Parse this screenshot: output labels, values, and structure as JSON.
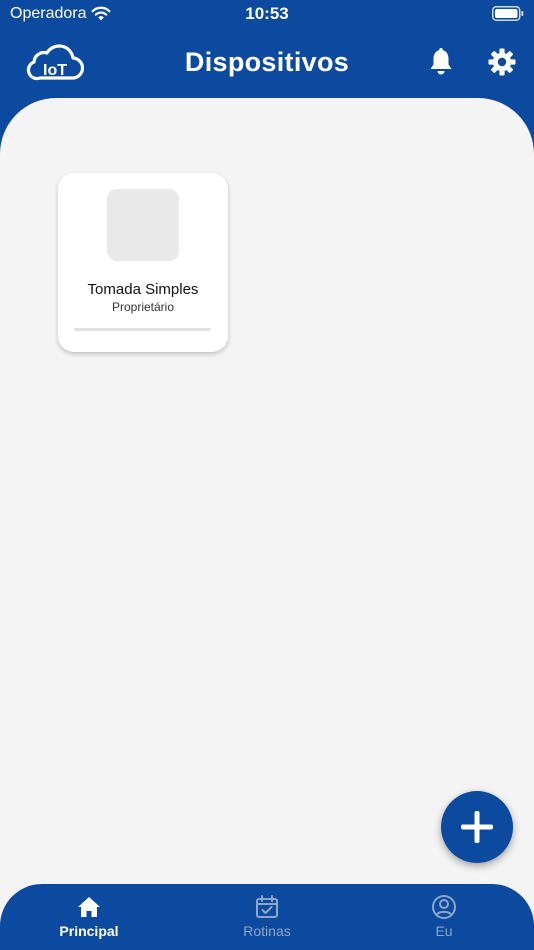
{
  "status_bar": {
    "carrier": "Operadora",
    "time": "10:53"
  },
  "header": {
    "title": "Dispositivos",
    "logo_text": "IoT"
  },
  "devices": [
    {
      "name": "Tomada Simples",
      "role": "Proprietário"
    }
  ],
  "tabs": [
    {
      "label": "Principal",
      "icon": "home-icon",
      "active": true
    },
    {
      "label": "Rotinas",
      "icon": "calendar-check-icon",
      "active": false
    },
    {
      "label": "Eu",
      "icon": "user-circle-icon",
      "active": false
    }
  ],
  "colors": {
    "primary": "#0B4A9E",
    "background": "#F4F4F4",
    "card": "#FFFFFF",
    "inactive_tab": "#8FA6C6"
  }
}
